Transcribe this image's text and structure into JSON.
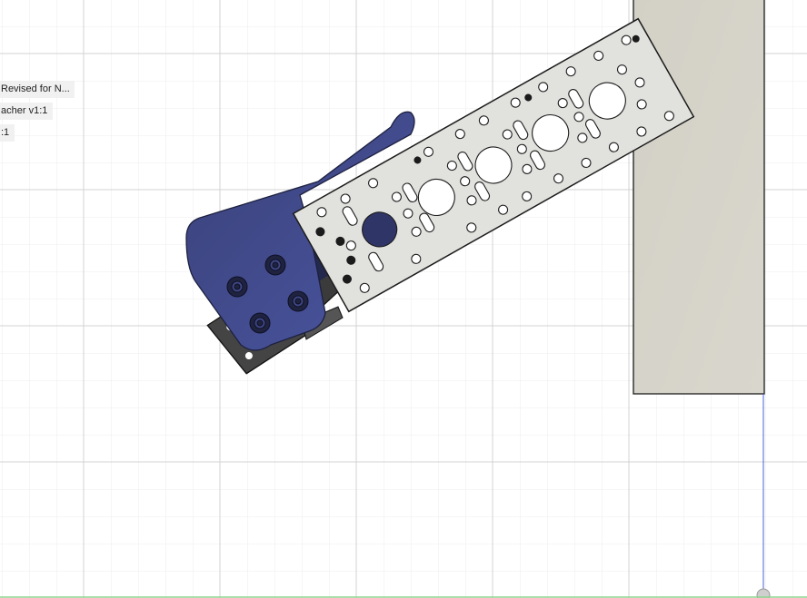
{
  "browser_labels": [
    {
      "text": "Revised for N..."
    },
    {
      "text": "acher v1:1"
    },
    {
      "text": ":1"
    }
  ],
  "colors": {
    "canvas_bg": "#ffffff",
    "grid_minor": "#ececec",
    "grid_major": "#d6d6d6",
    "plate": "#e1e1dd",
    "plate_edge": "#1c1c1c",
    "column": "#d3d1c6",
    "bracket_blue": "#3e4684",
    "bracket_dark": "#444444",
    "origin_axis": "#4a5fd8"
  },
  "icons": [
    "gear-icon",
    "origin-icon"
  ]
}
